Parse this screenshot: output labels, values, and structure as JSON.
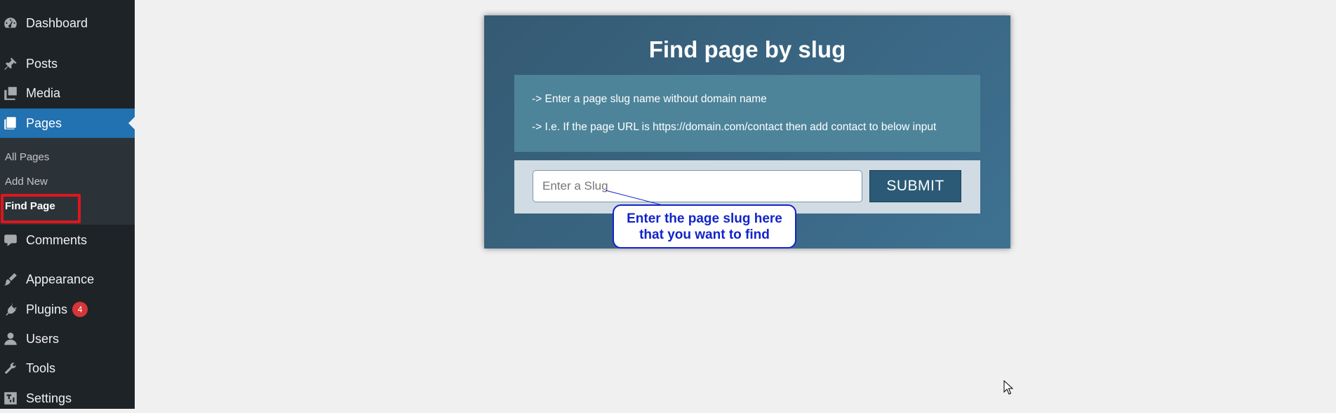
{
  "sidebar": {
    "items": {
      "dashboard": {
        "label": "Dashboard",
        "icon": "dashboard-icon"
      },
      "posts": {
        "label": "Posts",
        "icon": "pushpin-icon"
      },
      "media": {
        "label": "Media",
        "icon": "media-icon"
      },
      "pages": {
        "label": "Pages",
        "icon": "pages-icon"
      },
      "comments": {
        "label": "Comments",
        "icon": "comment-icon"
      },
      "appearance": {
        "label": "Appearance",
        "icon": "brush-icon"
      },
      "plugins": {
        "label": "Plugins",
        "icon": "plugin-icon",
        "badge": "4"
      },
      "users": {
        "label": "Users",
        "icon": "user-icon"
      },
      "tools": {
        "label": "Tools",
        "icon": "wrench-icon"
      },
      "settings": {
        "label": "Settings",
        "icon": "settings-icon"
      }
    },
    "submenu": {
      "all_pages": "All Pages",
      "add_new": "Add New",
      "find_page": "Find Page"
    },
    "colors": {
      "background": "#1d2327",
      "current": "#2271b1",
      "highlight": "#e0151d",
      "badge": "#d63638"
    }
  },
  "panel": {
    "title": "Find page by slug",
    "info_line_1": "-> Enter a page slug name without domain name",
    "info_line_2": "-> I.e. If the page URL is https://domain.com/contact then add contact to below input",
    "input_placeholder": "Enter a Slug",
    "input_value": "",
    "submit_label": "SUBMIT"
  },
  "callout": {
    "line1": "Enter the page slug here",
    "line2": "that you want to find",
    "color": "#1224c9"
  }
}
